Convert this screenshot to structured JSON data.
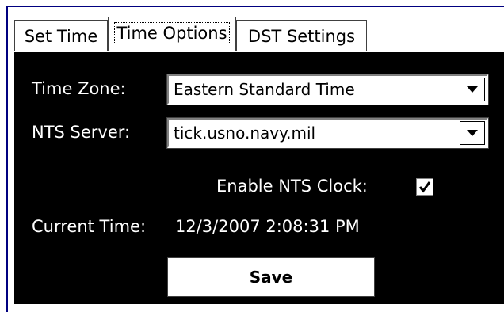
{
  "tabs": [
    {
      "label": "Set Time",
      "active": false
    },
    {
      "label": "Time Options",
      "active": true
    },
    {
      "label": "DST Settings",
      "active": false
    }
  ],
  "form": {
    "time_zone_label": "Time Zone:",
    "time_zone_value": "Eastern Standard Time",
    "nts_server_label": "NTS Server:",
    "nts_server_value": "tick.usno.navy.mil",
    "enable_nts_label": "Enable NTS Clock:",
    "enable_nts_checked": true,
    "current_time_label": "Current Time:",
    "current_time_value": "12/3/2007 2:08:31 PM",
    "save_label": "Save"
  },
  "icons": {
    "dropdown": "chevron-down-icon",
    "check": "checkmark-icon"
  },
  "colors": {
    "panel_bg": "#000000",
    "window_border": "#000080",
    "label_text": "#ffffff"
  }
}
